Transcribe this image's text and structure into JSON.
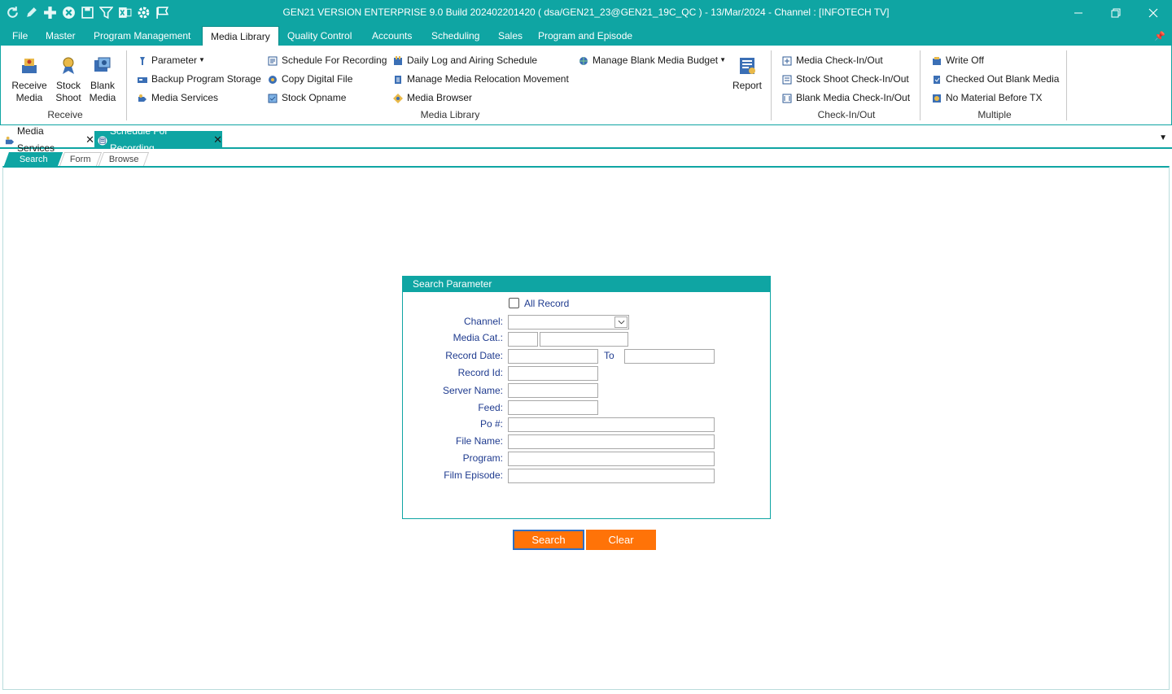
{
  "app": {
    "title": "GEN21 VERSION ENTERPRISE 9.0 Build 202402201420 ( dsa/GEN21_23@GEN21_19C_QC ) - 13/Mar/2024 - Channel : [INFOTECH TV]"
  },
  "colors": {
    "accent": "#0fa5a3",
    "button": "#ff7308",
    "label": "#1f3b8f"
  },
  "quick_access": [
    "refresh-icon",
    "pencil-icon",
    "add-icon",
    "cancel-icon",
    "save-icon",
    "filter-icon",
    "excel-icon",
    "settings-icon",
    "flag-icon"
  ],
  "menu": {
    "items": [
      "File",
      "Master",
      "Program Management",
      "Media Library",
      "Quality Control",
      "Accounts",
      "Scheduling",
      "Sales",
      "Program and Episode"
    ],
    "active": "Media Library"
  },
  "ribbon": {
    "receive": {
      "label": "Receive",
      "buttons": [
        {
          "line1": "Receive",
          "line2": "Media"
        },
        {
          "line1": "Stock",
          "line2": "Shoot"
        },
        {
          "line1": "Blank",
          "line2": "Media"
        }
      ]
    },
    "media_library": {
      "label": "Media Library",
      "col1": [
        "Parameter",
        "Backup Program Storage",
        "Media Services"
      ],
      "col2": [
        "Schedule For Recording",
        "Copy Digital File",
        "Stock Opname"
      ],
      "col3": [
        "Daily Log and Airing Schedule",
        "Manage Media Relocation Movement",
        "Media Browser"
      ],
      "col4": [
        "Manage Blank Media Budget"
      ],
      "report": "Report"
    },
    "checkinout": {
      "label": "Check-In/Out",
      "items": [
        "Media Check-In/Out",
        "Stock Shoot Check-In/Out",
        "Blank Media Check-In/Out"
      ]
    },
    "multiple": {
      "label": "Multiple",
      "items": [
        "Write Off",
        "Checked Out Blank Media",
        "No Material Before TX"
      ]
    }
  },
  "doc_tabs": [
    {
      "label": "Media Services",
      "active": false
    },
    {
      "label": "Schedule For Recording",
      "active": true
    }
  ],
  "sub_tabs": [
    "Search",
    "Form",
    "Browse"
  ],
  "search_panel": {
    "title": "Search Parameter",
    "all_record": "All Record",
    "labels": {
      "channel": "Channel:",
      "media_cat": "Media Cat.:",
      "record_date": "Record Date:",
      "to": "To",
      "record_id": "Record Id:",
      "server_name": "Server Name:",
      "feed": "Feed:",
      "po": "Po #:",
      "file_name": "File Name:",
      "program": "Program:",
      "film_episode": "Film Episode:"
    },
    "values": {
      "channel": "",
      "media_cat_code": "",
      "media_cat_name": "",
      "record_date_from": "",
      "record_date_to": "",
      "record_id": "",
      "server_name": "",
      "feed": "",
      "po": "",
      "file_name": "",
      "program": "",
      "film_episode": ""
    }
  },
  "actions": {
    "search": "Search",
    "clear": "Clear"
  }
}
